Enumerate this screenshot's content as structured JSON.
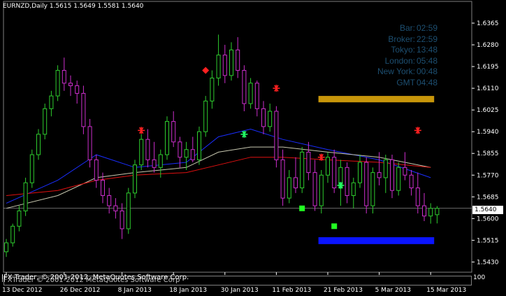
{
  "chart_title": "EURNZD,Daily  1.5615 1.5649 1.5581 1.5640",
  "info_panel": [
    {
      "label": "Bar:",
      "value": "02:59"
    },
    {
      "label": "Broker:",
      "value": "22:59"
    },
    {
      "label": "Tokyo:",
      "value": "13:48"
    },
    {
      "label": "London:",
      "value": "05:48"
    },
    {
      "label": "New York:",
      "value": "00:48"
    },
    {
      "label": "GMT",
      "value": "04:48"
    }
  ],
  "copyright": "IFX Trader, © 2001-2012, MetaQuotes Software Corp.",
  "copyright_shadow": "IFXTrader © 2001-2012 MetaQuotes Software Corp",
  "sub_window_scale": "100",
  "current_price_label": "1.5640",
  "colors": {
    "background": "#000000",
    "bull_candle": "#2ecc2e",
    "bear_candle": "#cc2ecc",
    "ma_fast": "#1a2eff",
    "ma_mid": "#c8c8b0",
    "ma_slow": "#e01010",
    "supply_zone": "#c8960a",
    "demand_zone": "#0a14ff",
    "info_text": "#1d4f71"
  },
  "chart_data": {
    "type": "candlestick",
    "symbol": "EURNZD",
    "timeframe": "Daily",
    "ylim": [
      1.54,
      1.64
    ],
    "y_ticks": [
      "1.6365",
      "1.6280",
      "1.6195",
      "1.6110",
      "1.6025",
      "1.5940",
      "1.5855",
      "1.5770",
      "1.5685",
      "1.5600",
      "1.5515",
      "1.5430"
    ],
    "x_ticks": [
      "13 Dec 2012",
      "26 Dec 2012",
      "8 Jan 2013",
      "18 Jan 2013",
      "30 Jan 2013",
      "11 Feb 2013",
      "21 Feb 2013",
      "5 Mar 2013",
      "15 Mar 2013"
    ],
    "x_tick_bar_index": [
      0,
      9,
      18,
      26,
      34,
      42,
      50,
      58,
      66
    ],
    "candles": [
      [
        1.547,
        1.552,
        1.545,
        1.5505
      ],
      [
        1.5505,
        1.558,
        1.549,
        1.557
      ],
      [
        1.557,
        1.565,
        1.555,
        1.563
      ],
      [
        1.563,
        1.576,
        1.561,
        1.574
      ],
      [
        1.574,
        1.587,
        1.572,
        1.585
      ],
      [
        1.585,
        1.595,
        1.583,
        1.593
      ],
      [
        1.593,
        1.605,
        1.591,
        1.603
      ],
      [
        1.603,
        1.61,
        1.6,
        1.608
      ],
      [
        1.608,
        1.62,
        1.606,
        1.618
      ],
      [
        1.618,
        1.623,
        1.61,
        1.613
      ],
      [
        1.613,
        1.616,
        1.608,
        1.612
      ],
      [
        1.612,
        1.614,
        1.605,
        1.609
      ],
      [
        1.609,
        1.612,
        1.593,
        1.596
      ],
      [
        1.596,
        1.599,
        1.58,
        1.583
      ],
      [
        1.583,
        1.585,
        1.572,
        1.575
      ],
      [
        1.575,
        1.578,
        1.566,
        1.569
      ],
      [
        1.569,
        1.572,
        1.562,
        1.565
      ],
      [
        1.565,
        1.568,
        1.56,
        1.563
      ],
      [
        1.563,
        1.566,
        1.552,
        1.556
      ],
      [
        1.556,
        1.572,
        1.554,
        1.57
      ],
      [
        1.57,
        1.583,
        1.568,
        1.581
      ],
      [
        1.581,
        1.593,
        1.579,
        1.591
      ],
      [
        1.591,
        1.595,
        1.58,
        1.583
      ],
      [
        1.583,
        1.59,
        1.578,
        1.58
      ],
      [
        1.58,
        1.587,
        1.576,
        1.585
      ],
      [
        1.585,
        1.6,
        1.583,
        1.598
      ],
      [
        1.598,
        1.602,
        1.588,
        1.59
      ],
      [
        1.59,
        1.592,
        1.58,
        1.584
      ],
      [
        1.584,
        1.59,
        1.579,
        1.587
      ],
      [
        1.587,
        1.592,
        1.582,
        1.583
      ],
      [
        1.583,
        1.596,
        1.581,
        1.594
      ],
      [
        1.594,
        1.608,
        1.592,
        1.606
      ],
      [
        1.606,
        1.618,
        1.603,
        1.615
      ],
      [
        1.615,
        1.632,
        1.612,
        1.624
      ],
      [
        1.624,
        1.628,
        1.613,
        1.616
      ],
      [
        1.616,
        1.629,
        1.614,
        1.626
      ],
      [
        1.626,
        1.631,
        1.615,
        1.618
      ],
      [
        1.618,
        1.62,
        1.602,
        1.605
      ],
      [
        1.605,
        1.615,
        1.603,
        1.613
      ],
      [
        1.613,
        1.614,
        1.6,
        1.603
      ],
      [
        1.603,
        1.606,
        1.593,
        1.596
      ],
      [
        1.596,
        1.605,
        1.594,
        1.602
      ],
      [
        1.602,
        1.604,
        1.58,
        1.583
      ],
      [
        1.583,
        1.587,
        1.565,
        1.568
      ],
      [
        1.568,
        1.579,
        1.566,
        1.576
      ],
      [
        1.576,
        1.584,
        1.57,
        1.572
      ],
      [
        1.572,
        1.588,
        1.57,
        1.586
      ],
      [
        1.586,
        1.59,
        1.575,
        1.578
      ],
      [
        1.578,
        1.583,
        1.563,
        1.565
      ],
      [
        1.565,
        1.579,
        1.562,
        1.577
      ],
      [
        1.577,
        1.586,
        1.574,
        1.584
      ],
      [
        1.584,
        1.587,
        1.57,
        1.572
      ],
      [
        1.572,
        1.583,
        1.565,
        1.58
      ],
      [
        1.58,
        1.582,
        1.566,
        1.569
      ],
      [
        1.569,
        1.576,
        1.564,
        1.574
      ],
      [
        1.574,
        1.585,
        1.572,
        1.582
      ],
      [
        1.582,
        1.584,
        1.562,
        1.565
      ],
      [
        1.565,
        1.58,
        1.562,
        1.578
      ],
      [
        1.578,
        1.586,
        1.573,
        1.576
      ],
      [
        1.576,
        1.585,
        1.57,
        1.583
      ],
      [
        1.583,
        1.585,
        1.568,
        1.571
      ],
      [
        1.571,
        1.582,
        1.569,
        1.58
      ],
      [
        1.58,
        1.586,
        1.575,
        1.577
      ],
      [
        1.577,
        1.579,
        1.569,
        1.572
      ],
      [
        1.572,
        1.578,
        1.562,
        1.565
      ],
      [
        1.565,
        1.57,
        1.559,
        1.561
      ],
      [
        1.561,
        1.566,
        1.558,
        1.564
      ],
      [
        1.5615,
        1.5649,
        1.5581,
        1.564
      ]
    ],
    "current_price": 1.564,
    "moving_averages": [
      {
        "name": "ma_fast",
        "start": 1.566,
        "points": [
          [
            0,
            1.566
          ],
          [
            8,
            1.575
          ],
          [
            14,
            1.585
          ],
          [
            20,
            1.58
          ],
          [
            28,
            1.582
          ],
          [
            33,
            1.592
          ],
          [
            38,
            1.595
          ],
          [
            43,
            1.591
          ],
          [
            50,
            1.587
          ],
          [
            58,
            1.583
          ],
          [
            66,
            1.576
          ]
        ]
      },
      {
        "name": "ma_mid",
        "points": [
          [
            0,
            1.564
          ],
          [
            8,
            1.569
          ],
          [
            14,
            1.576
          ],
          [
            20,
            1.578
          ],
          [
            28,
            1.58
          ],
          [
            33,
            1.586
          ],
          [
            38,
            1.588
          ],
          [
            43,
            1.588
          ],
          [
            50,
            1.586
          ],
          [
            58,
            1.584
          ],
          [
            66,
            1.58
          ]
        ]
      },
      {
        "name": "ma_slow",
        "points": [
          [
            0,
            1.569
          ],
          [
            8,
            1.571
          ],
          [
            14,
            1.575
          ],
          [
            20,
            1.577
          ],
          [
            28,
            1.578
          ],
          [
            33,
            1.581
          ],
          [
            38,
            1.584
          ],
          [
            43,
            1.584
          ],
          [
            50,
            1.583
          ],
          [
            58,
            1.582
          ],
          [
            66,
            1.58
          ]
        ]
      }
    ],
    "zones": [
      {
        "name": "supply-zone",
        "y_top": 1.608,
        "y_bottom": 1.6055,
        "from_bar": 48,
        "to_bar": 66
      },
      {
        "name": "demand-zone",
        "y_top": 1.5527,
        "y_bottom": 1.55,
        "from_bar": 48,
        "to_bar": 66
      }
    ],
    "markers": [
      {
        "type": "star",
        "color": "#ff2020",
        "bar": 21,
        "price": 1.5945
      },
      {
        "type": "diamond",
        "color": "#ff2020",
        "bar": 31,
        "price": 1.618
      },
      {
        "type": "star",
        "color": "#ff2020",
        "bar": 42,
        "price": 1.611
      },
      {
        "type": "star",
        "color": "#22ff66",
        "bar": 37,
        "price": 1.593
      },
      {
        "type": "star",
        "color": "#ff2020",
        "bar": 49,
        "price": 1.584
      },
      {
        "type": "square",
        "color": "#22ff22",
        "bar": 46,
        "price": 1.564
      },
      {
        "type": "star",
        "color": "#22ff66",
        "bar": 52,
        "price": 1.573
      },
      {
        "type": "square",
        "color": "#22ff22",
        "bar": 51,
        "price": 1.557
      },
      {
        "type": "star",
        "color": "#ff2020",
        "bar": 64,
        "price": 1.5945
      }
    ]
  }
}
